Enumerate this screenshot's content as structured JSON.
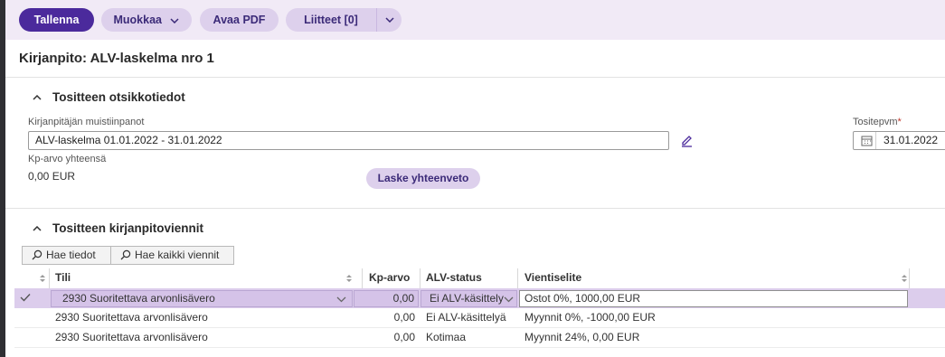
{
  "toolbar": {
    "save_label": "Tallenna",
    "edit_label": "Muokkaa",
    "pdf_label": "Avaa PDF",
    "attachments_label": "Liitteet [0]"
  },
  "page": {
    "title": "Kirjanpito: ALV-laskelma nro 1"
  },
  "header_section": {
    "title": "Tositteen otsikkotiedot",
    "notes_label": "Kirjanpitäjän muistiinpanot",
    "notes_value": "ALV-laskelma 01.01.2022 - 31.01.2022",
    "date_label": "Tositepvm",
    "date_required": "*",
    "date_value": "31.01.2022",
    "total_label": "Kp-arvo yhteensä",
    "total_value": "0,00 EUR",
    "summary_button": "Laske yhteenveto"
  },
  "entries_section": {
    "title": "Tositteen kirjanpitoviennit",
    "fetch_button": "Hae tiedot",
    "fetch_all_button": "Hae kaikki viennit",
    "columns": {
      "account": "Tili",
      "value": "Kp-arvo",
      "vat_status": "ALV-status",
      "description": "Vientiselite"
    },
    "rows": [
      {
        "account": "2930 Suoritettava arvonlisävero",
        "value": "0,00",
        "vat_status": "Ei ALV-käsittely",
        "description": "Ostot 0%, 1000,00 EUR"
      },
      {
        "account": "2930 Suoritettava arvonlisävero",
        "value": "0,00",
        "vat_status": "Ei ALV-käsittelyä",
        "description": "Myynnit 0%, -1000,00 EUR"
      },
      {
        "account": "2930 Suoritettava arvonlisävero",
        "value": "0,00",
        "vat_status": "Kotimaa",
        "description": "Myynnit 24%, 0,00 EUR"
      }
    ]
  },
  "colors": {
    "primary": "#4b2a9c",
    "secondary": "#ddd0ec",
    "toolbar_bg": "#f1eaf6",
    "selected_row": "#dccdec"
  }
}
